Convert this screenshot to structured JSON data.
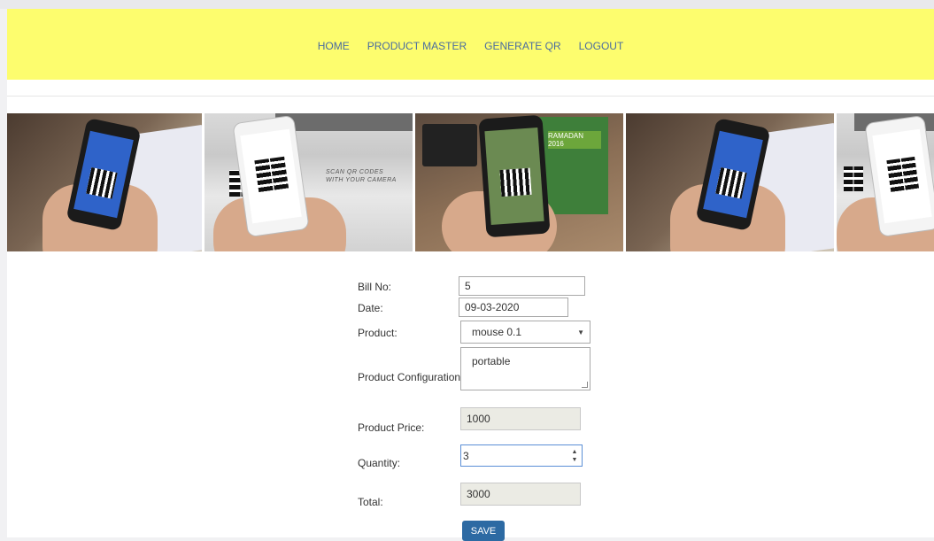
{
  "nav": {
    "items": [
      {
        "label": "HOME"
      },
      {
        "label": "PRODUCT MASTER"
      },
      {
        "label": "GENERATE QR"
      },
      {
        "label": "LOGOUT"
      }
    ]
  },
  "banner": {
    "caption": "SCAN QR CODES\nWITH YOUR CAMERA",
    "poster_text": "RAMADAN 2016"
  },
  "form": {
    "bill_no_label": "Bill No:",
    "bill_no_value": "5",
    "date_label": "Date:",
    "date_value": "09-03-2020",
    "product_label": "Product:",
    "product_value": "mouse 0.1",
    "config_label": "Product Configuration:",
    "config_value": "portable",
    "price_label": "Product Price:",
    "price_value": "1000",
    "quantity_label": "Quantity:",
    "quantity_value": "3",
    "total_label": "Total:",
    "total_value": "3000",
    "save_label": "SAVE"
  },
  "colors": {
    "navbar_bg": "#fdfd6e",
    "nav_link": "#4a6ca0",
    "save_button": "#2d6aa3",
    "readonly_field": "#ebebe4"
  }
}
